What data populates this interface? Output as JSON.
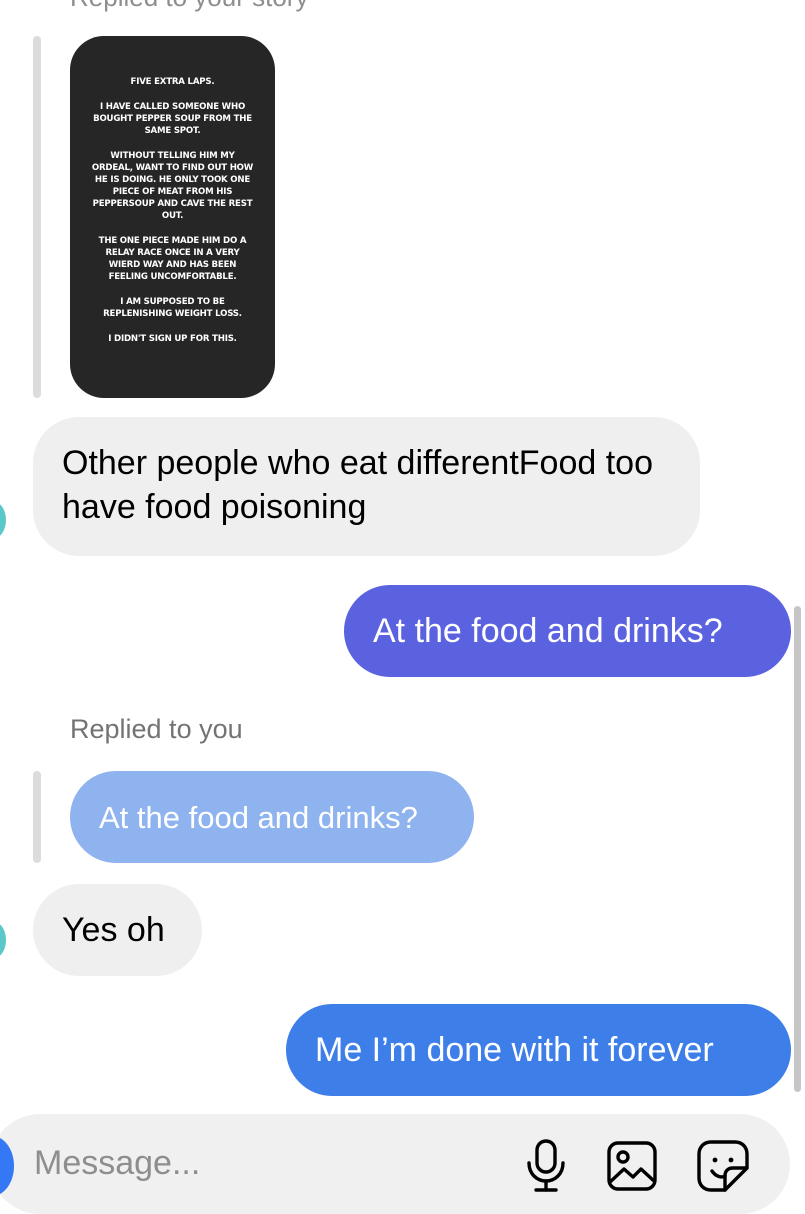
{
  "thread": {
    "story_reply_label": "Replied to your story",
    "story_lines": [
      "Five extra laps.",
      "I have called someone who bought pepper soup from the same spot.",
      "Without telling him my ordeal, want to find out how he is doing. He only took one piece of meat from his peppersoup and cave the rest out.",
      "The one piece made him do a relay race once in a very wierd way and has been feeling uncomfortable.",
      "I am supposed to be replenishing weight loss.",
      "I didn't sign up for this."
    ],
    "messages": [
      {
        "text": "Other people who eat differentFood too have food poisoning"
      },
      {
        "text": "At the food and drinks?"
      },
      {
        "text": "Yes oh"
      },
      {
        "text": "Me I’m done with it forever"
      }
    ],
    "reply_label": "Replied to you",
    "quoted_text": "At the food and drinks?"
  },
  "composer": {
    "placeholder": "Message..."
  },
  "icons": {
    "mic": "microphone-icon",
    "photo": "photo-gallery-icon",
    "sticker": "sticker-icon"
  },
  "colors": {
    "incoming_bubble": "#efefef",
    "outgoing_bubble_top": "#5b62e0",
    "outgoing_bubble_bottom": "#3d7ee9",
    "quoted_bubble": "#8fb3ef",
    "story_card": "#262626"
  }
}
